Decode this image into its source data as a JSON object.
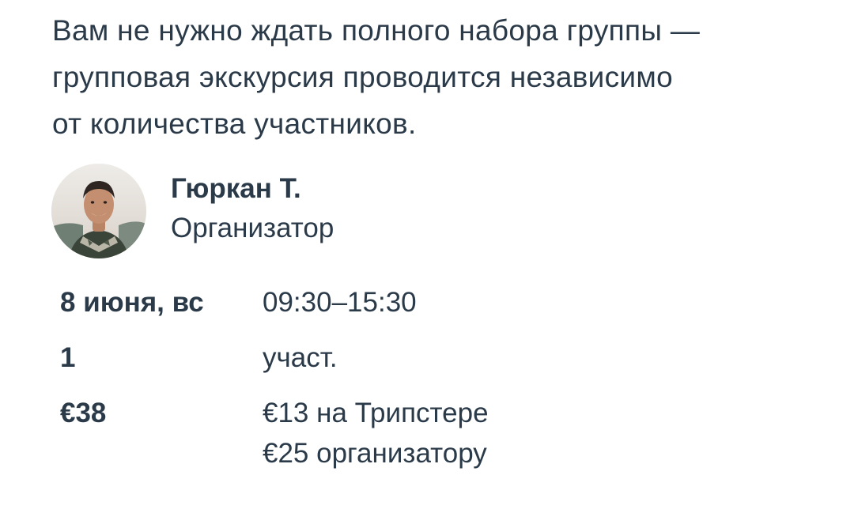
{
  "intro": {
    "lines": [
      "Вам не нужно ждать полного набора группы —",
      "групповая экскурсия проводится независимо",
      "от количества участников."
    ]
  },
  "organizer": {
    "name": "Гюркан Т.",
    "role": "Организатор",
    "avatar_icon": "organizer-photo"
  },
  "details": {
    "date": "8 июня, вс",
    "time": "09:30–15:30",
    "participants_count": "1",
    "participants_label": "участ.",
    "price_total": "€38",
    "price_breakdown": [
      "€13 на Трипстере",
      "€25 организатору"
    ]
  },
  "colors": {
    "text": "#2b3a49",
    "background": "#ffffff"
  }
}
